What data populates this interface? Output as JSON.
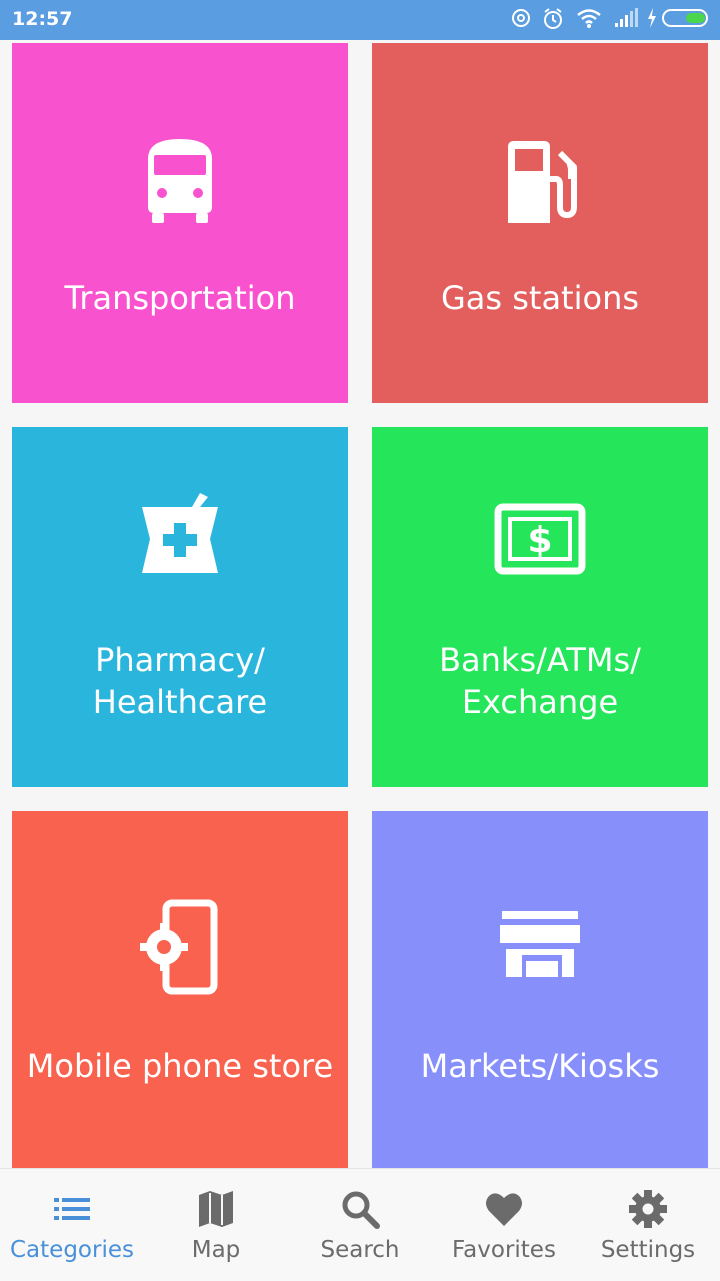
{
  "status_bar": {
    "time": "12:57"
  },
  "tiles": [
    {
      "label": "Transportation",
      "icon": "bus-icon",
      "color": "#f952ce"
    },
    {
      "label": "Gas stations",
      "icon": "gas-station-icon",
      "color": "#e25f5d"
    },
    {
      "label_line1": "Pharmacy/",
      "label_line2": "Healthcare",
      "icon": "pharmacy-icon",
      "color": "#2ab6dc"
    },
    {
      "label_line1": "Banks/ATMs/",
      "label_line2": "Exchange",
      "icon": "money-icon",
      "color": "#25e55a"
    },
    {
      "label": "Mobile phone store",
      "icon": "phone-settings-icon",
      "color": "#f8624e"
    },
    {
      "label": "Markets/Kiosks",
      "icon": "store-icon",
      "color": "#868ffa"
    }
  ],
  "bottom_nav": {
    "active_color": "#4a90d9",
    "items": [
      {
        "label": "Categories",
        "icon": "list-icon",
        "active": true
      },
      {
        "label": "Map",
        "icon": "map-icon",
        "active": false
      },
      {
        "label": "Search",
        "icon": "search-icon",
        "active": false
      },
      {
        "label": "Favorites",
        "icon": "heart-icon",
        "active": false
      },
      {
        "label": "Settings",
        "icon": "gear-icon",
        "active": false
      }
    ]
  }
}
